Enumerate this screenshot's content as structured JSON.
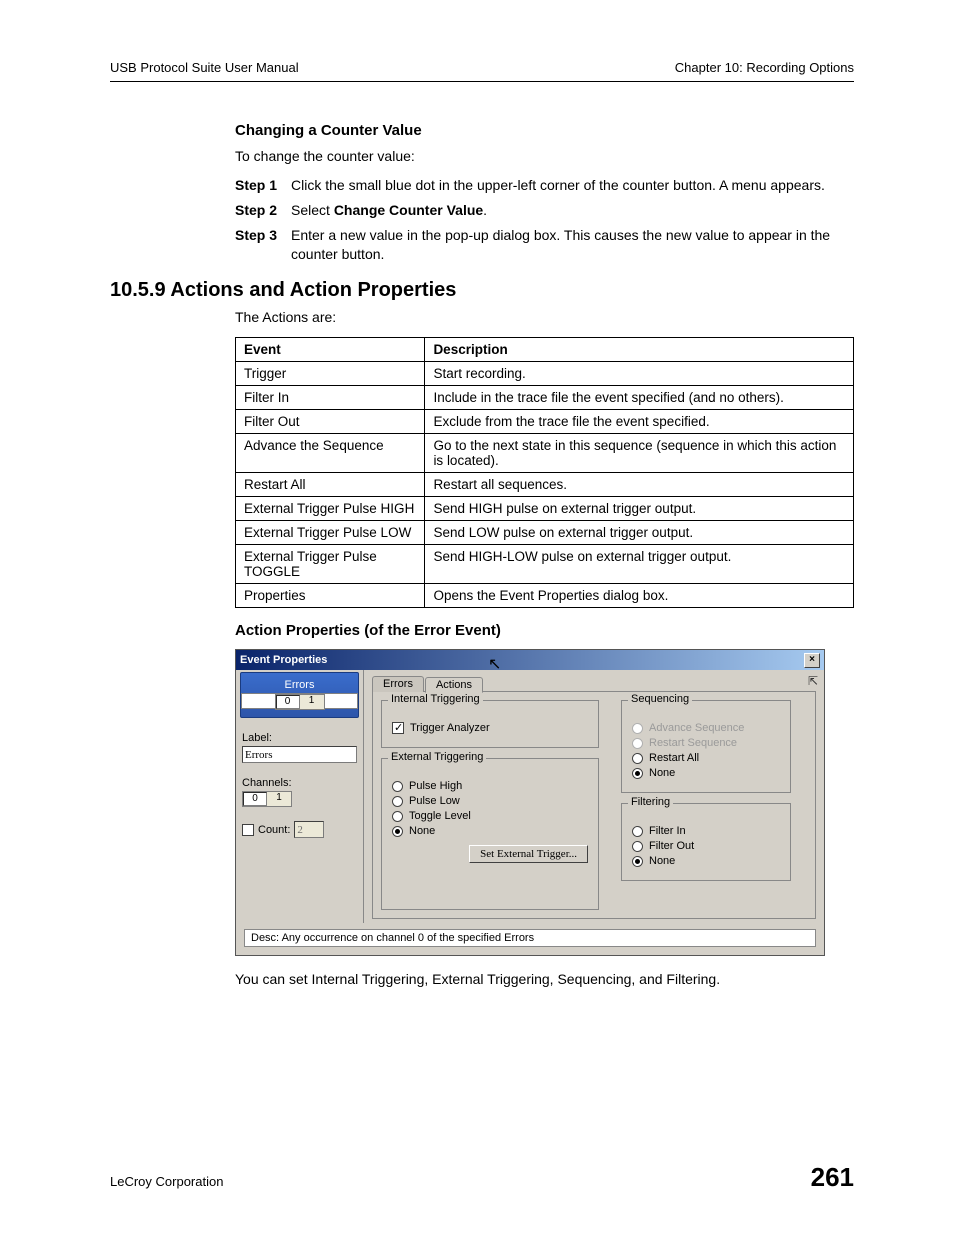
{
  "header": {
    "left": "USB Protocol Suite User Manual",
    "right": "Chapter 10: Recording Options"
  },
  "section1": {
    "h4": "Changing a Counter Value",
    "intro": "To change the counter value:",
    "steps": [
      {
        "label": "Step 1",
        "body": "Click the small blue dot in the upper-left corner of the counter button. A menu appears."
      },
      {
        "label": "Step 2",
        "body_pre": "Select ",
        "body_bold": "Change Counter Value",
        "body_post": "."
      },
      {
        "label": "Step 3",
        "body": "Enter a new value in the pop-up dialog box. This causes the new value to appear in the counter button."
      }
    ]
  },
  "section2": {
    "h2": "10.5.9 Actions and Action Properties",
    "intro": "The Actions are:",
    "table": {
      "headers": [
        "Event",
        "Description"
      ],
      "rows": [
        [
          "Trigger",
          "Start recording."
        ],
        [
          "Filter In",
          "Include in the trace file the event specified (and no others)."
        ],
        [
          "Filter Out",
          "Exclude from the trace file the event specified."
        ],
        [
          "Advance the Sequence",
          "Go to the next state in this sequence (sequence in which this action is located)."
        ],
        [
          "Restart All",
          "Restart all sequences."
        ],
        [
          "External Trigger Pulse HIGH",
          "Send HIGH pulse on external trigger output."
        ],
        [
          "External Trigger Pulse LOW",
          "Send LOW pulse on external trigger output."
        ],
        [
          "External Trigger Pulse TOGGLE",
          "Send HIGH-LOW pulse on external trigger output."
        ],
        [
          "Properties",
          "Opens the Event Properties dialog box."
        ]
      ]
    },
    "h4b": "Action Properties (of the Error Event)",
    "after": "You can set Internal Triggering, External Triggering, Sequencing, and Filtering."
  },
  "dialog": {
    "title": "Event Properties",
    "side": {
      "errors_label": "Errors",
      "toggle": [
        "0",
        "1"
      ],
      "label_label": "Label:",
      "label_value": "Errors",
      "channels_label": "Channels:",
      "channels_toggle": [
        "0",
        "1"
      ],
      "count_label": "Count:",
      "count_value": "2"
    },
    "tabs": {
      "errors": "Errors",
      "actions": "Actions"
    },
    "internal": {
      "title": "Internal Triggering",
      "trigger_analyzer": "Trigger Analyzer"
    },
    "external": {
      "title": "External Triggering",
      "pulse_high": "Pulse High",
      "pulse_low": "Pulse Low",
      "toggle_level": "Toggle Level",
      "none": "None",
      "button": "Set External Trigger..."
    },
    "sequencing": {
      "title": "Sequencing",
      "adv": "Advance Sequence",
      "restart_seq": "Restart Sequence",
      "restart_all": "Restart All",
      "none": "None"
    },
    "filtering": {
      "title": "Filtering",
      "in": "Filter In",
      "out": "Filter Out",
      "none": "None"
    },
    "desc": "Desc: Any occurrence on channel 0 of the specified Errors"
  },
  "footer": {
    "company": "LeCroy Corporation",
    "page": "261"
  }
}
